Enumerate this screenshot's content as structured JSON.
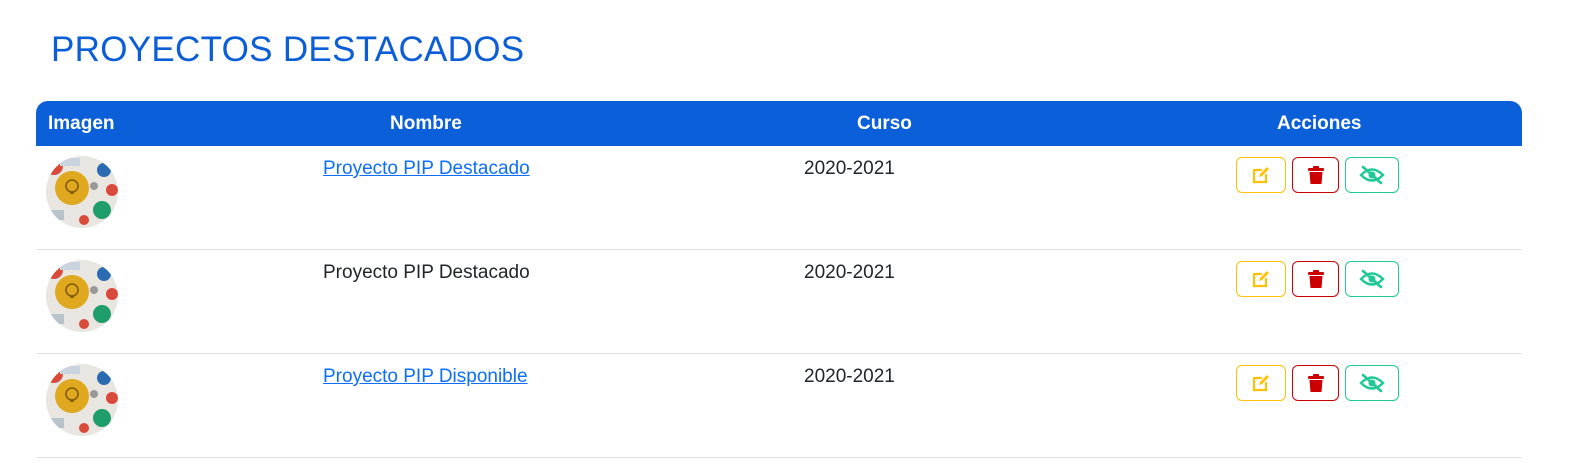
{
  "page": {
    "title": "PROYECTOS DESTACADOS"
  },
  "table": {
    "headers": {
      "image": "Imagen",
      "name": "Nombre",
      "course": "Curso",
      "actions": "Acciones"
    },
    "rows": [
      {
        "name": "Proyecto PIP Destacado",
        "name_is_link": true,
        "course": "2020-2021"
      },
      {
        "name": "Proyecto PIP Destacado",
        "name_is_link": false,
        "course": "2020-2021"
      },
      {
        "name": "Proyecto PIP Disponible",
        "name_is_link": true,
        "course": "2020-2021"
      }
    ]
  },
  "icons": {
    "edit": "edit-icon",
    "delete": "trash-icon",
    "hide": "eye-slash-icon"
  },
  "colors": {
    "primary": "#0b5fd9",
    "link": "#0d6efd",
    "edit": "#ffc107",
    "delete": "#cc0000",
    "hide": "#20c997"
  }
}
